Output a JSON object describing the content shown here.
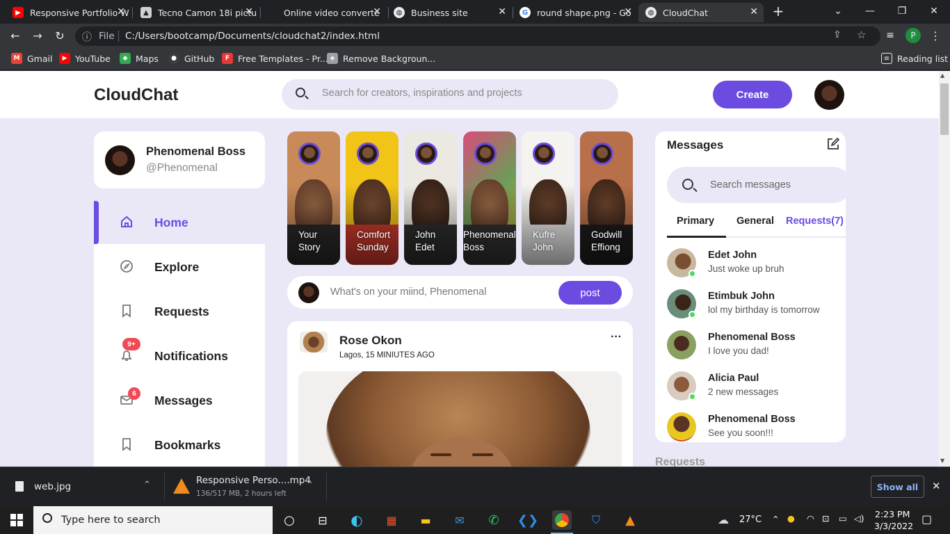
{
  "browser": {
    "tabs": [
      {
        "title": "Responsive Portfolio W",
        "icon": "youtube-icon",
        "color": "#ff0000"
      },
      {
        "title": "Tecno Camon 18i pictu",
        "icon": "image-icon",
        "color": "#d0d0d0"
      },
      {
        "title": "Online video converte",
        "icon": "converter-icon",
        "color": "#202124"
      },
      {
        "title": "Business site",
        "icon": "globe-icon",
        "color": "#e8eaed"
      },
      {
        "title": "round shape.png - Go",
        "icon": "google-icon",
        "color": "#4285f4"
      },
      {
        "title": "CloudChat",
        "icon": "globe-icon",
        "color": "#e8eaed"
      }
    ],
    "url_scheme": "File",
    "url": "C:/Users/bootcamp/Documents/cloudchat2/index.html",
    "profile_initial": "P",
    "bookmarks": [
      {
        "label": "Gmail",
        "icon": "gmail-icon",
        "color": "#ea4335"
      },
      {
        "label": "YouTube",
        "icon": "youtube-icon",
        "color": "#ff0000"
      },
      {
        "label": "Maps",
        "icon": "maps-icon",
        "color": "#34a853"
      },
      {
        "label": "GitHub",
        "icon": "github-icon",
        "color": "#3c3c3c"
      },
      {
        "label": "Free Templates - Pr...",
        "icon": "templates-icon",
        "color": "#e53935"
      },
      {
        "label": "Remove Backgroun...",
        "icon": "layers-icon",
        "color": "#9aa0a6"
      }
    ],
    "reading_list": "Reading list"
  },
  "app": {
    "logo": "CloudChat",
    "search_placeholder": "Search for creators, inspirations and projects",
    "create_label": "Create",
    "accent": "#6b4be0",
    "background": "#eae8f7"
  },
  "profile": {
    "name": "Phenomenal Boss",
    "handle": "@Phenomenal"
  },
  "sidebar": {
    "items": [
      {
        "label": "Home",
        "icon": "home-icon",
        "active": true
      },
      {
        "label": "Explore",
        "icon": "compass-icon"
      },
      {
        "label": "Requests",
        "icon": "bookmark-icon"
      },
      {
        "label": "Notifications",
        "icon": "bell-icon",
        "badge": "9+"
      },
      {
        "label": "Messages",
        "icon": "envelope-icon",
        "badge": "6"
      },
      {
        "label": "Bookmarks",
        "icon": "bookmark-icon"
      }
    ]
  },
  "stories": [
    {
      "line1": "Your",
      "line2": "Story",
      "bg": "#c98a5a"
    },
    {
      "line1": "Comfort",
      "line2": "Sunday",
      "bg": "#f2c418"
    },
    {
      "line1": "John",
      "line2": "Edet",
      "bg": "#ece8e2"
    },
    {
      "line1": "Phenomenal",
      "line2": "Boss",
      "bg": "#6b9d58"
    },
    {
      "line1": "Kufre",
      "line2": "John",
      "bg": "#f5f3f0"
    },
    {
      "line1": "Godwill",
      "line2": "Effiong",
      "bg": "#b8704a"
    }
  ],
  "composer": {
    "placeholder": "What's on your miind, Phenomenal",
    "post_label": "post"
  },
  "feed": {
    "author": "Rose Okon",
    "meta": "Lagos, 15 MINIUTES AGO",
    "more": "···"
  },
  "messages": {
    "title": "Messages",
    "search_placeholder": "Search messages",
    "tabs": [
      "Primary",
      "General",
      "Requests(7)"
    ],
    "list": [
      {
        "name": "Edet John",
        "text": "Just woke up bruh",
        "online": true,
        "bg": "#c9b8a0"
      },
      {
        "name": "Etimbuk John",
        "text": "lol my birthday is tomorrow",
        "online": true,
        "bg": "#6a8d7a"
      },
      {
        "name": "Phenomenal Boss",
        "text": "I love you dad!",
        "online": false,
        "bg": "#8aa060"
      },
      {
        "name": "Alicia Paul",
        "text": "2 new messages",
        "online": true,
        "bg": "#d8cbc0"
      },
      {
        "name": "Phenomenal Boss",
        "text": "See you soon!!!",
        "online": false,
        "bg": "#e8c820"
      }
    ]
  },
  "requests_title": "Requests",
  "downloads": [
    {
      "name": "web.jpg",
      "icon": "file-icon"
    },
    {
      "name": "Responsive Perso....mp4",
      "status": "136/517 MB, 2 hours left",
      "icon": "vlc-icon"
    }
  ],
  "show_all": "Show all",
  "taskbar": {
    "search_placeholder": "Type here to search",
    "temperature": "27°C",
    "time": "2:23 PM",
    "date": "3/3/2022"
  }
}
